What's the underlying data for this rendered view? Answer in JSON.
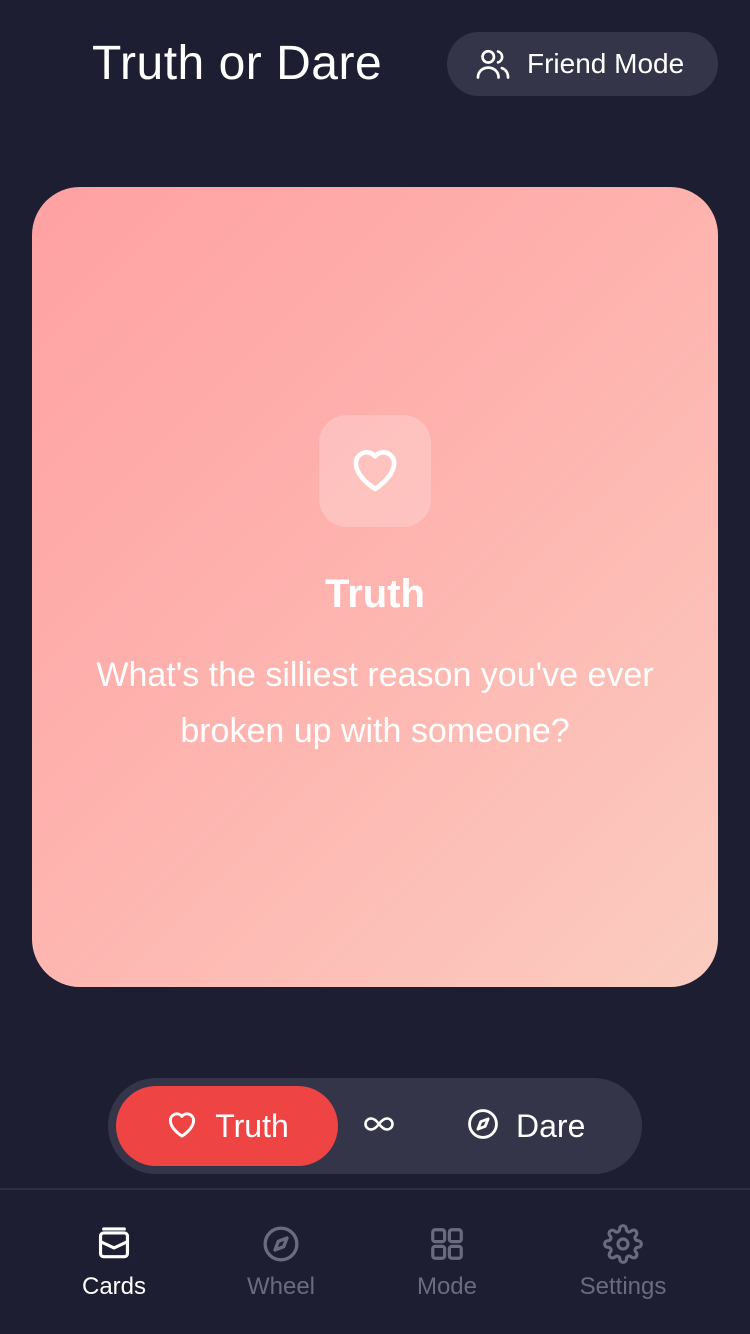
{
  "header": {
    "title": "Truth or Dare",
    "mode_chip": {
      "label": "Friend Mode",
      "icon": "users-icon"
    }
  },
  "card": {
    "icon": "heart-icon",
    "category": "Truth",
    "question": "What's the silliest reason you've ever broken up with someone?",
    "gradient": [
      "#ffa1a3",
      "#feb2ae",
      "#fbccc0"
    ]
  },
  "toggle": {
    "truth_label": "Truth",
    "truth_icon": "heart-icon",
    "random_icon": "infinity-icon",
    "dare_label": "Dare",
    "dare_icon": "compass-icon",
    "selected": "Truth",
    "active_color": "#ef4444"
  },
  "nav": {
    "items": [
      {
        "label": "Cards",
        "icon": "cards-icon",
        "active": true
      },
      {
        "label": "Wheel",
        "icon": "compass-icon",
        "active": false
      },
      {
        "label": "Mode",
        "icon": "grid-icon",
        "active": false
      },
      {
        "label": "Settings",
        "icon": "gear-icon",
        "active": false
      }
    ]
  },
  "colors": {
    "background": "#1e1e33",
    "surface": "#35354a",
    "inactive_text": "#6b6b80"
  }
}
